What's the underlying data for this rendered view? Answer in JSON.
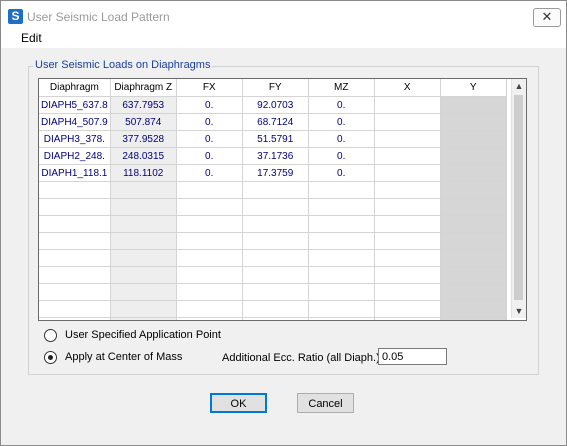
{
  "window": {
    "title": "User Seismic Load Pattern",
    "app_icon_letter": "S",
    "close_glyph": "✕"
  },
  "menu": {
    "items": [
      "Edit"
    ]
  },
  "group": {
    "legend": "User Seismic Loads on Diaphragms",
    "columns": [
      "Diaphragm",
      "Diaphragm Z",
      "FX",
      "FY",
      "MZ",
      "X",
      "Y"
    ],
    "rows": [
      [
        "DIAPH5_637.8",
        "637.7953",
        "0.",
        "92.0703",
        "0.",
        "",
        ""
      ],
      [
        "DIAPH4_507.9",
        "507.874",
        "0.",
        "68.7124",
        "0.",
        "",
        ""
      ],
      [
        "DIAPH3_378.",
        "377.9528",
        "0.",
        "51.5791",
        "0.",
        "",
        ""
      ],
      [
        "DIAPH2_248.",
        "248.0315",
        "0.",
        "37.1736",
        "0.",
        "",
        ""
      ],
      [
        "DIAPH1_118.1",
        "118.1102",
        "0.",
        "17.3759",
        "0.",
        "",
        ""
      ]
    ],
    "empty_row_count": 9
  },
  "options": {
    "radio_user_point": "User Specified Application Point",
    "radio_center_mass": "Apply at Center of Mass",
    "selected": "center_of_mass",
    "ecc_label": "Additional Ecc. Ratio (all Diaph.)",
    "ecc_value": "0.05"
  },
  "buttons": {
    "ok": "OK",
    "cancel": "Cancel"
  },
  "colors": {
    "accent": "#0078d7",
    "grid_text": "#000080",
    "legend": "#1a3f9e"
  }
}
